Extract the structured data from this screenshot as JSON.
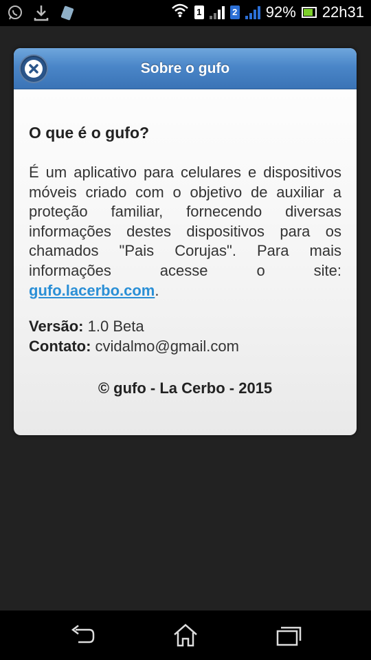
{
  "status_bar": {
    "battery_percent": "92%",
    "time": "22h31",
    "sim1_label": "1",
    "sim2_label": "2",
    "icons": [
      "whatsapp-icon",
      "download-icon",
      "app-notification-icon",
      "wifi-icon",
      "signal-icon",
      "battery-icon"
    ],
    "battery_fill_color": "#7ccf2a",
    "sim2_color": "#2b6fd6"
  },
  "dialog": {
    "title": "Sobre o gufo",
    "close_icon": "close-icon",
    "heading": "O que é o gufo?",
    "description": "É um aplicativo para celulares e dispositivos móveis criado com o objetivo de auxiliar a proteção familiar, fornecendo diversas informações destes dispositivos para os chamados \"Pais Corujas\". Para mais informações acesse o site:",
    "site_link": "gufo.lacerbo.com",
    "after_link": ".",
    "version_label": "Versão:",
    "version_value": "1.0 Beta",
    "contact_label": "Contato:",
    "contact_value": "cvidalmo@gmail.com",
    "copyright": "© gufo - La Cerbo - 2015",
    "header_color": "#4a86c8",
    "link_color": "#2a8fd6"
  },
  "nav_bar": {
    "buttons": [
      "back-icon",
      "home-icon",
      "recent-apps-icon"
    ]
  }
}
